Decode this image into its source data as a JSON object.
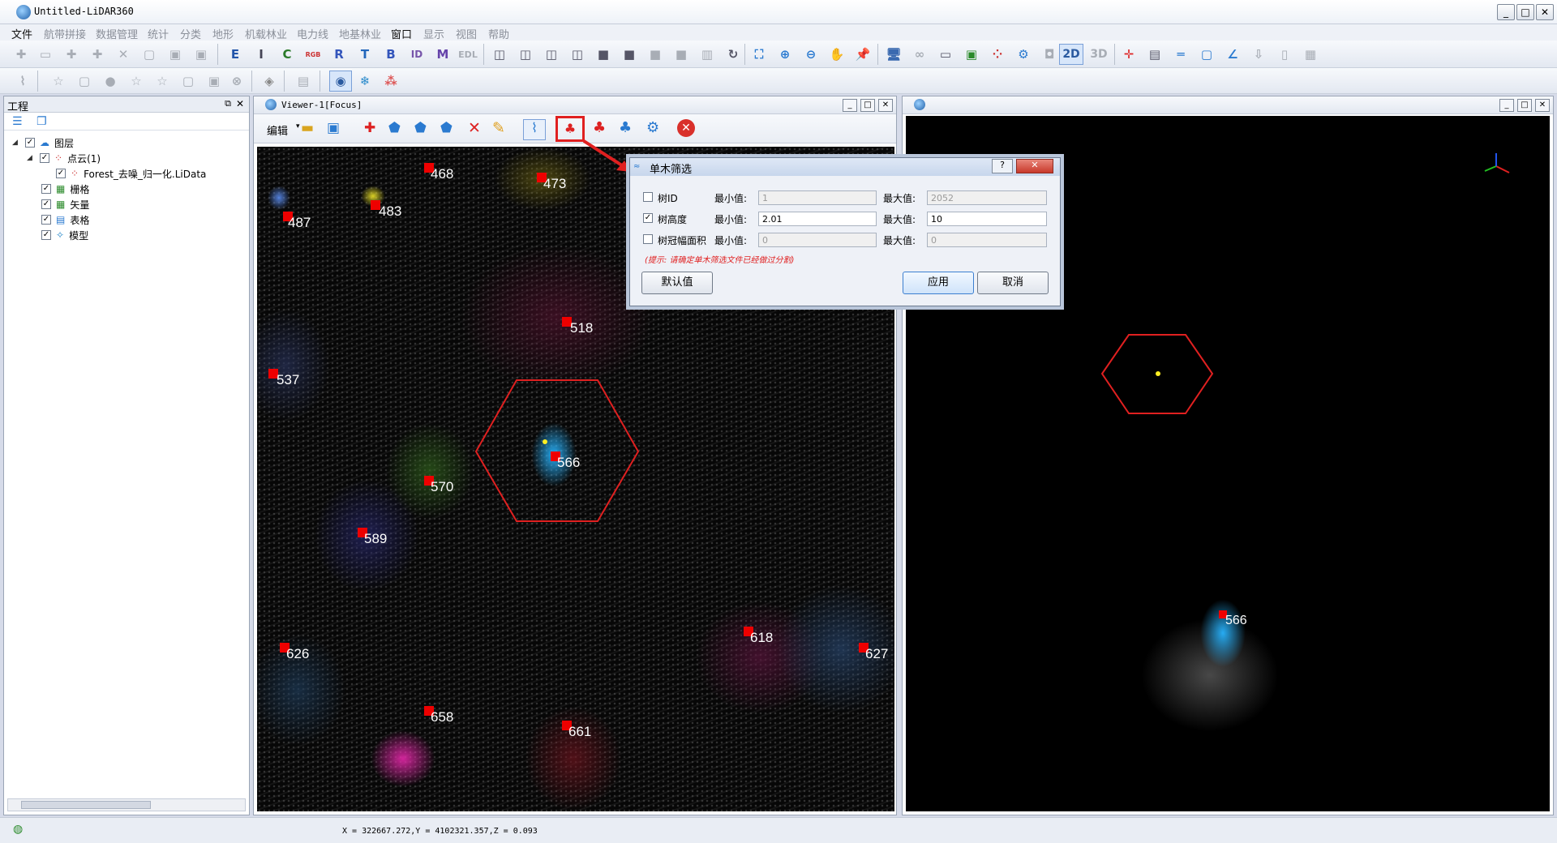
{
  "app": {
    "title": "Untitled-LiDAR360"
  },
  "menu": [
    "文件",
    "航带拼接",
    "数据管理",
    "统计",
    "分类",
    "地形",
    "机载林业",
    "电力线",
    "地基林业",
    "窗口",
    "显示",
    "视图",
    "帮助"
  ],
  "toolbar": {
    "letters": [
      "E",
      "I",
      "C",
      "RGB",
      "R",
      "T",
      "B",
      "ID",
      "M",
      "EDL"
    ],
    "mode_2d": "2D",
    "mode_3d": "3D"
  },
  "project": {
    "title": "工程",
    "root": "图层",
    "pointcloud": "点云(1)",
    "file": "Forest_去噪_归一化.LiData",
    "raster": "栅格",
    "vector": "矢量",
    "table": "表格",
    "model": "模型"
  },
  "viewer1": {
    "title": "Viewer-1[Focus]",
    "edit_label": "编辑",
    "tree_labels": [
      "468",
      "473",
      "487",
      "483",
      "518",
      "537",
      "566",
      "570",
      "589",
      "618",
      "626",
      "627",
      "658",
      "661"
    ]
  },
  "viewer2": {
    "label": "566"
  },
  "dialog": {
    "title": "单木筛选",
    "rows": [
      {
        "label": "树ID",
        "checked": false,
        "min_label": "最小值:",
        "min": "1",
        "max_label": "最大值:",
        "max": "2052"
      },
      {
        "label": "树高度",
        "checked": true,
        "min_label": "最小值:",
        "min": "2.01",
        "max_label": "最大值:",
        "max": "10"
      },
      {
        "label": "树冠幅面积",
        "checked": false,
        "min_label": "最小值:",
        "min": "0",
        "max_label": "最大值:",
        "max": "0"
      }
    ],
    "hint": "(提示: 请确定单木筛选文件已经做过分割)",
    "default_button": "默认值",
    "apply_button": "应用",
    "cancel_button": "取消"
  },
  "status": {
    "coords": "X = 322667.272,Y = 4102321.357,Z = 0.093"
  }
}
